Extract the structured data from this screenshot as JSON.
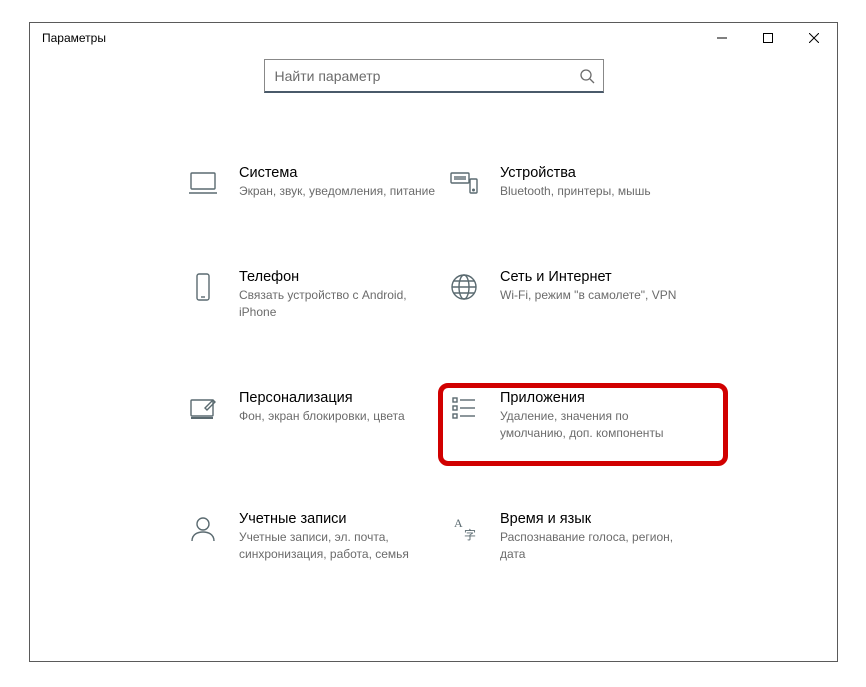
{
  "window": {
    "title": "Параметры"
  },
  "search": {
    "placeholder": "Найти параметр"
  },
  "tiles": {
    "system": {
      "title": "Система",
      "sub": "Экран, звук, уведомления, питание"
    },
    "devices": {
      "title": "Устройства",
      "sub": "Bluetooth, принтеры, мышь"
    },
    "phone": {
      "title": "Телефон",
      "sub": "Связать устройство с Android, iPhone"
    },
    "network": {
      "title": "Сеть и Интернет",
      "sub": "Wi-Fi, режим \"в самолете\", VPN"
    },
    "personalization": {
      "title": "Персонализация",
      "sub": "Фон, экран блокировки, цвета"
    },
    "apps": {
      "title": "Приложения",
      "sub": "Удаление, значения по умолчанию, доп. компоненты"
    },
    "accounts": {
      "title": "Учетные записи",
      "sub": "Учетные записи, эл. почта, синхронизация, работа, семья"
    },
    "time": {
      "title": "Время и язык",
      "sub": "Распознавание голоса, регион, дата"
    }
  }
}
